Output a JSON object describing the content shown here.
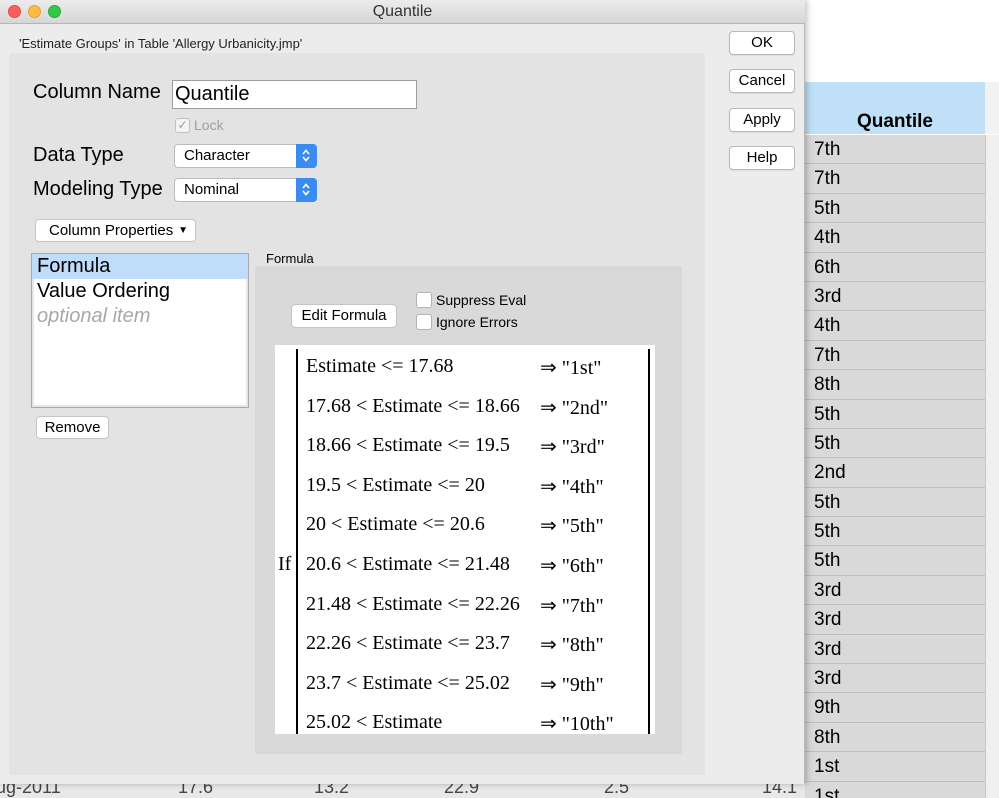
{
  "window": {
    "title": "Quantile",
    "subtitle": "'Estimate Groups' in Table 'Allergy Urbanicity.jmp'"
  },
  "buttons": {
    "ok": "OK",
    "cancel": "Cancel",
    "apply": "Apply",
    "help": "Help"
  },
  "form": {
    "column_name_label": "Column Name",
    "column_name_value": "Quantile",
    "lock_label": "Lock",
    "lock_checked": true,
    "data_type_label": "Data Type",
    "data_type_value": "Character",
    "modeling_type_label": "Modeling Type",
    "modeling_type_value": "Nominal",
    "column_properties_label": "Column Properties"
  },
  "properties_list": {
    "items": [
      "Formula",
      "Value Ordering"
    ],
    "placeholder": "optional item",
    "remove_label": "Remove"
  },
  "formula": {
    "section_label": "Formula",
    "edit_label": "Edit Formula",
    "suppress_eval_label": "Suppress Eval",
    "ignore_errors_label": "Ignore Errors",
    "if_keyword": "If",
    "clauses": [
      {
        "condition": "Estimate <= 17.68",
        "result": "⇒ \"1st\""
      },
      {
        "condition": "17.68 < Estimate <= 18.66",
        "result": "⇒ \"2nd\""
      },
      {
        "condition": "18.66 < Estimate <= 19.5",
        "result": "⇒ \"3rd\""
      },
      {
        "condition": "19.5 < Estimate <= 20",
        "result": "⇒ \"4th\""
      },
      {
        "condition": "20 < Estimate <= 20.6",
        "result": "⇒ \"5th\""
      },
      {
        "condition": "20.6 < Estimate <= 21.48",
        "result": "⇒ \"6th\""
      },
      {
        "condition": "21.48 < Estimate <= 22.26",
        "result": "⇒ \"7th\""
      },
      {
        "condition": "22.26 < Estimate <= 23.7",
        "result": "⇒ \"8th\""
      },
      {
        "condition": "23.7 < Estimate <= 25.02",
        "result": "⇒ \"9th\""
      },
      {
        "condition": "25.02 < Estimate",
        "result": "⇒ \"10th\""
      }
    ]
  },
  "data_table": {
    "column_header": "Quantile",
    "rows": [
      "7th",
      "7th",
      "5th",
      "4th",
      "6th",
      "3rd",
      "4th",
      "7th",
      "8th",
      "5th",
      "5th",
      "2nd",
      "5th",
      "5th",
      "5th",
      "3rd",
      "3rd",
      "3rd",
      "3rd",
      "9th",
      "8th",
      "1st",
      "1st"
    ]
  },
  "bottom_row": {
    "cells": [
      "ug-2011",
      "17.6",
      "13.2",
      "22.9",
      "2.5",
      "14.1"
    ]
  },
  "colors": {
    "accent": "#3b8cf0",
    "selection": "#bfdcfb",
    "header": "#bfe0f6"
  }
}
